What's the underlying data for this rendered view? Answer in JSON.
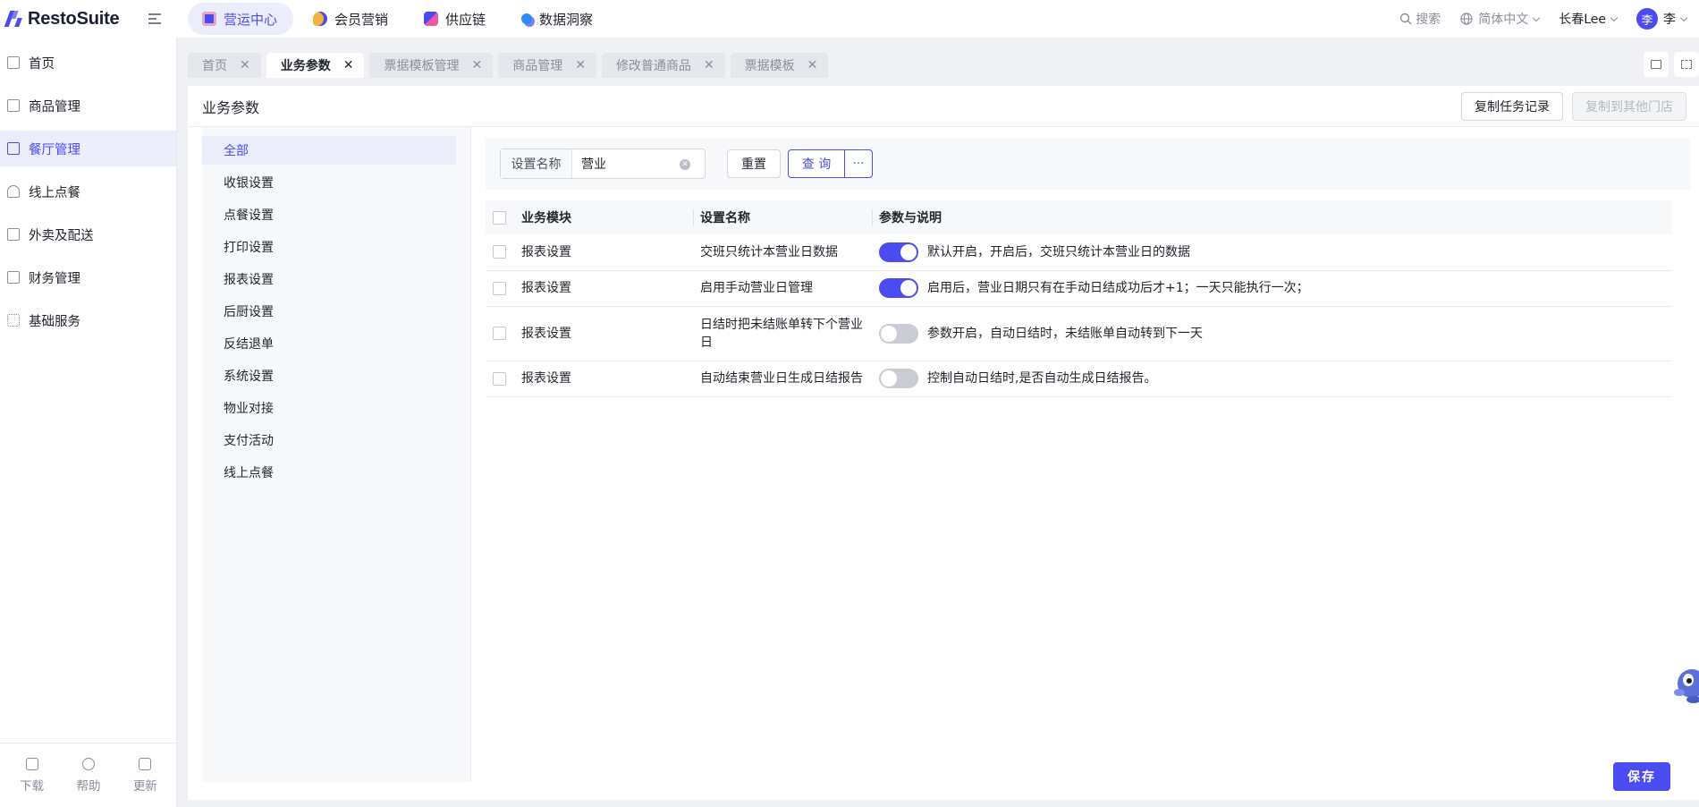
{
  "brand": {
    "name": "RestoSuite"
  },
  "topnav": [
    {
      "label": "营运中心",
      "active": true,
      "color": "#4b4cf0"
    },
    {
      "label": "会员营销",
      "active": false,
      "color": "#f2b33d"
    },
    {
      "label": "供应链",
      "active": false,
      "color": "#4b4cf0"
    },
    {
      "label": "数据洞察",
      "active": false,
      "color": "#2f8cf0"
    }
  ],
  "topright": {
    "search": "搜索",
    "language": "简体中文",
    "org": "长春Lee",
    "avatar_initial": "李",
    "user": "李"
  },
  "sidebar": {
    "items": [
      {
        "label": "首页",
        "active": false
      },
      {
        "label": "商品管理",
        "active": false
      },
      {
        "label": "餐厅管理",
        "active": true
      },
      {
        "label": "线上点餐",
        "active": false
      },
      {
        "label": "外卖及配送",
        "active": false
      },
      {
        "label": "财务管理",
        "active": false
      },
      {
        "label": "基础服务",
        "active": false
      }
    ],
    "bottom": [
      {
        "label": "下载"
      },
      {
        "label": "帮助"
      },
      {
        "label": "更新"
      }
    ]
  },
  "tabs": [
    {
      "label": "首页",
      "active": false
    },
    {
      "label": "业务参数",
      "active": true
    },
    {
      "label": "票据模板管理",
      "active": false
    },
    {
      "label": "商品管理",
      "active": false
    },
    {
      "label": "修改普通商品",
      "active": false
    },
    {
      "label": "票据模板",
      "active": false
    }
  ],
  "panel": {
    "title": "业务参数",
    "copy_log": "复制任务记录",
    "copy_to_stores": "复制到其他门店",
    "save": "保存"
  },
  "categories": [
    {
      "label": "全部",
      "active": true
    },
    {
      "label": "收银设置"
    },
    {
      "label": "点餐设置"
    },
    {
      "label": "打印设置"
    },
    {
      "label": "报表设置"
    },
    {
      "label": "后厨设置"
    },
    {
      "label": "反结退单"
    },
    {
      "label": "系统设置"
    },
    {
      "label": "物业对接"
    },
    {
      "label": "支付活动"
    },
    {
      "label": "线上点餐"
    }
  ],
  "filter": {
    "label": "设置名称",
    "value": "营业",
    "reset": "重置",
    "query": "查 询",
    "more": "···"
  },
  "table": {
    "columns": [
      "业务模块",
      "设置名称",
      "参数与说明"
    ],
    "rows": [
      {
        "module": "报表设置",
        "name": "交班只统计本营业日数据",
        "enabled": true,
        "desc": "默认开启，开启后，交班只统计本营业日的数据"
      },
      {
        "module": "报表设置",
        "name": "启用手动营业日管理",
        "enabled": true,
        "desc": "启用后，营业日期只有在手动日结成功后才+1；一天只能执行一次；"
      },
      {
        "module": "报表设置",
        "name": "日结时把未结账单转下个营业日",
        "enabled": false,
        "desc": "参数开启，自动日结时，未结账单自动转到下一天"
      },
      {
        "module": "报表设置",
        "name": "自动结束营业日生成日结报告",
        "enabled": false,
        "desc": "控制自动日结时,是否自动生成日结报告。"
      }
    ]
  }
}
